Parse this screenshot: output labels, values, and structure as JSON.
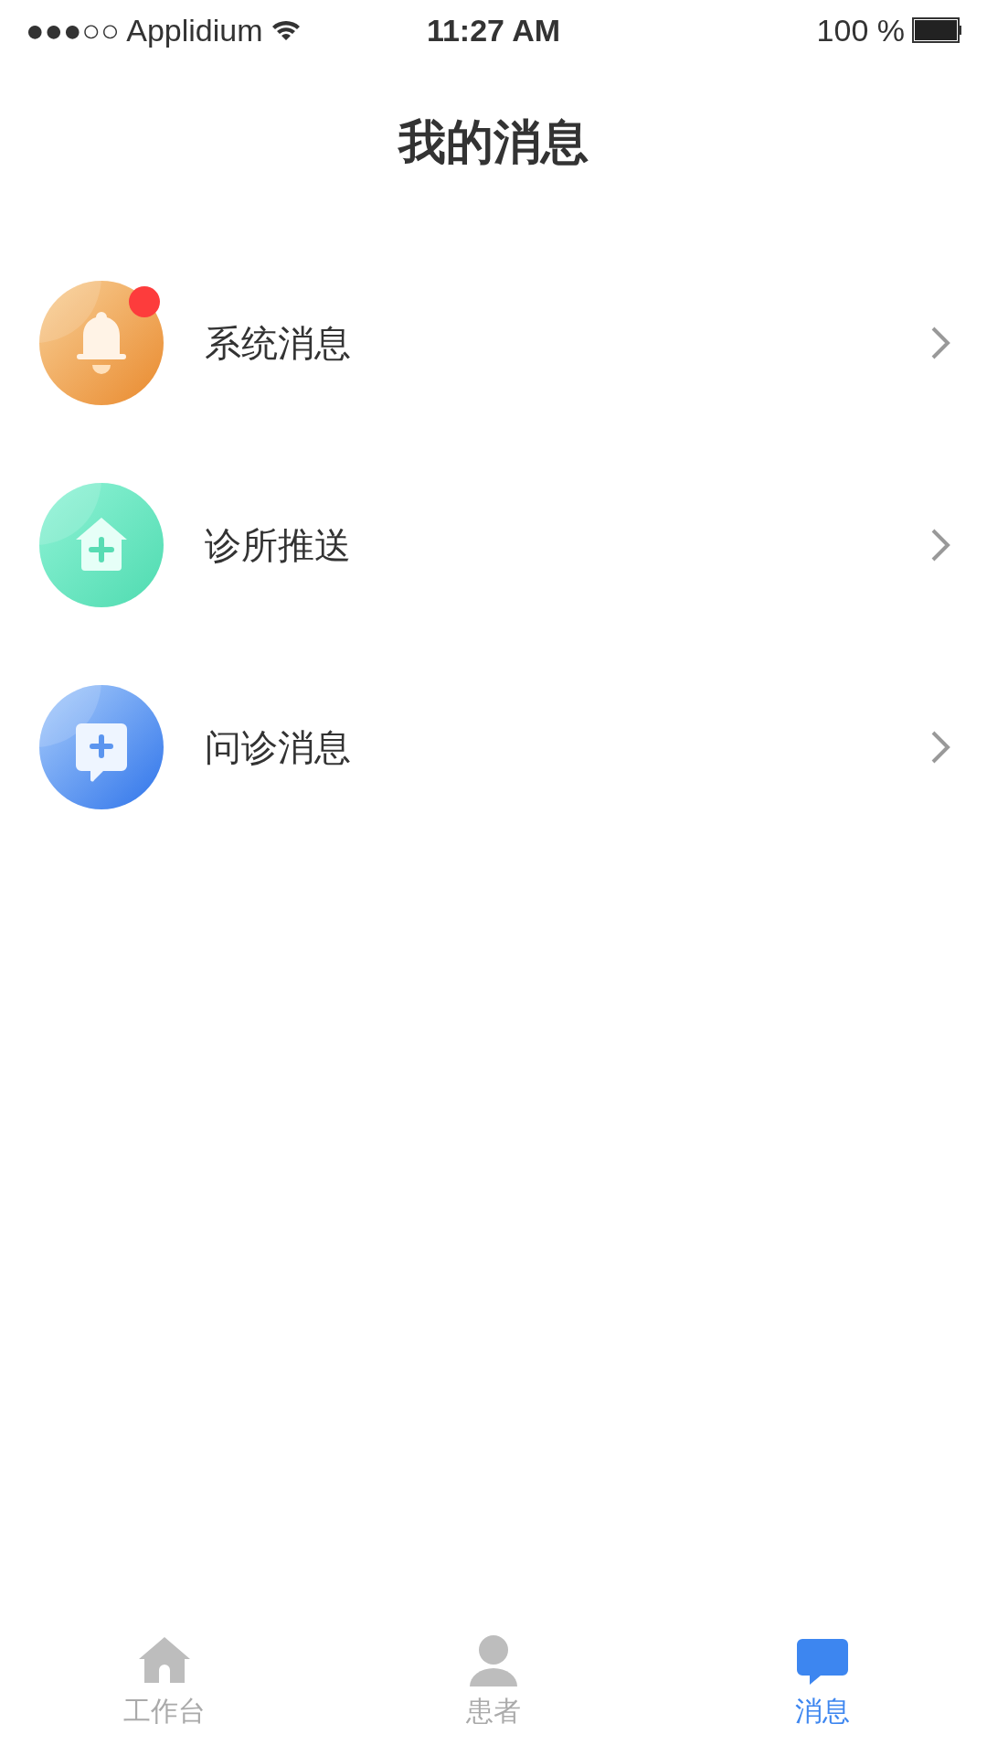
{
  "status_bar": {
    "carrier": "●●●○○ Applidium",
    "time": "11:27 AM",
    "battery": "100 %"
  },
  "title": "我的消息",
  "messages": [
    {
      "kind": "bell",
      "label": "系统消息",
      "unread": true
    },
    {
      "kind": "clinic",
      "label": "诊所推送",
      "unread": false
    },
    {
      "kind": "chat",
      "label": "问诊消息",
      "unread": false
    }
  ],
  "tabs": [
    {
      "kind": "home",
      "label": "工作台",
      "selected": false
    },
    {
      "kind": "person",
      "label": "患者",
      "selected": false
    },
    {
      "kind": "chat",
      "label": "消息",
      "selected": true
    }
  ]
}
